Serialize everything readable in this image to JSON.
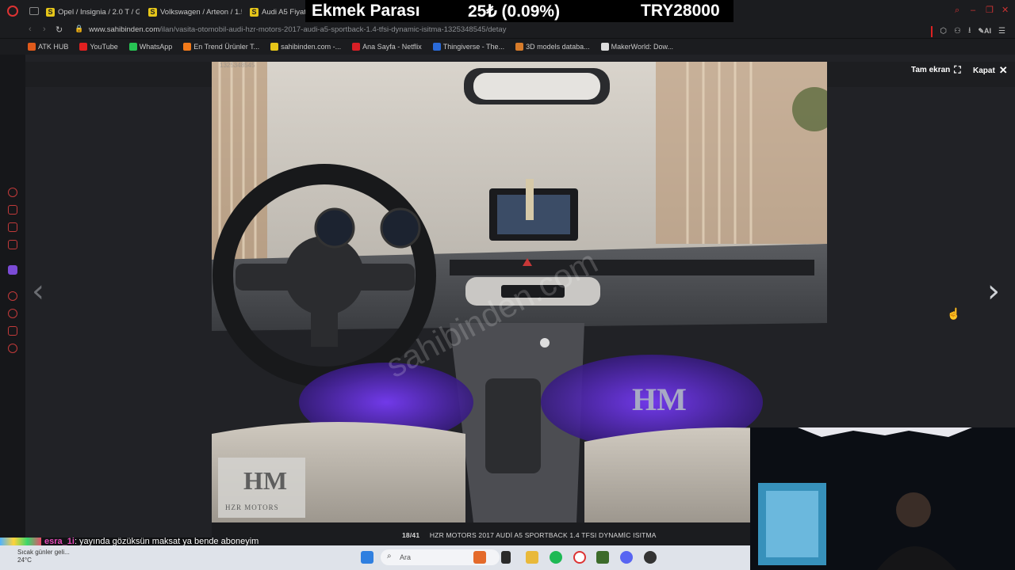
{
  "tabs": [
    {
      "label": "Opel / Insignia / 2.0 T / Gra"
    },
    {
      "label": "Volkswagen / Arteon / 1.5"
    },
    {
      "label": "Audi A5 Fiyatlar"
    }
  ],
  "stream_overlay": {
    "label": "Ekmek Parası",
    "amount": "25₺ (0.09%)",
    "goal": "TRY28000"
  },
  "address_bar": {
    "url_host": "www.sahibinden.com",
    "url_path": "/ilan/vasita-otomobil-audi-hzr-motors-2017-audi-a5-sportback-1.4-tfsi-dynamic-isitma-1325348545/detay",
    "ai_label": "AI"
  },
  "bookmarks": [
    {
      "label": "ATK HUB",
      "icon": "atk-icon",
      "color": "#e05a1b"
    },
    {
      "label": "YouTube",
      "icon": "youtube-icon",
      "color": "#e02020"
    },
    {
      "label": "WhatsApp",
      "icon": "whatsapp-icon",
      "color": "#27c454"
    },
    {
      "label": "En Trend Ürünler T...",
      "icon": "trendyol-icon",
      "color": "#f27a1a"
    },
    {
      "label": "sahibinden.com -...",
      "icon": "sahibinden-icon",
      "color": "#e6c619"
    },
    {
      "label": "Ana Sayfa - Netflix",
      "icon": "netflix-icon",
      "color": "#d81f26"
    },
    {
      "label": "Thingiverse - The...",
      "icon": "thingiverse-icon",
      "color": "#2a6ad8"
    },
    {
      "label": "3D models databa...",
      "icon": "3dmodels-icon",
      "color": "#d67b2a"
    },
    {
      "label": "MakerWorld: Dow...",
      "icon": "makerworld-icon",
      "color": "#dddddd"
    }
  ],
  "viewer": {
    "fullscreen_label": "Tam ekran",
    "close_label": "Kapat",
    "counter": "18/41",
    "caption": "HZR MOTORS 2017 AUDİ A5 SPORTBACK 1.4 TFSI DYNAMİC ISITMA",
    "watermark": "HZR MOTORS",
    "faded_id": "1325348545"
  },
  "chat": {
    "user": "esra_1i",
    "message": ": yayında gözüksün maksat ya bende aboneyim"
  },
  "taskbar": {
    "weather_text": "Sıcak günler geli...",
    "temperature": "24°C",
    "search_placeholder": "Ara"
  }
}
